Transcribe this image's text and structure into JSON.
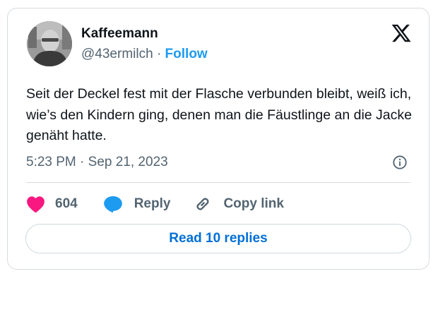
{
  "user": {
    "display_name": "Kaffeemann",
    "handle": "@43ermilch",
    "separator": "·",
    "follow_label": "Follow"
  },
  "tweet": {
    "text": "Seit der Deckel fest mit der Flasche verbunden bleibt, weiß ich, wie’s den Kindern ging, denen man die Fäustlinge an die Jacke genäht hatte.",
    "time": "5:23 PM",
    "separator": "·",
    "date": "Sep 21, 2023"
  },
  "actions": {
    "like_count": "604",
    "reply_label": "Reply",
    "copy_link_label": "Copy link"
  },
  "read_replies_label": "Read 10 replies",
  "colors": {
    "accent": "#1d9bf0",
    "like": "#f91880",
    "button_text": "#006fd6",
    "muted": "#536471"
  },
  "icons": [
    "x-logo-icon",
    "info-icon",
    "heart-icon",
    "reply-bubble-icon",
    "link-icon"
  ]
}
